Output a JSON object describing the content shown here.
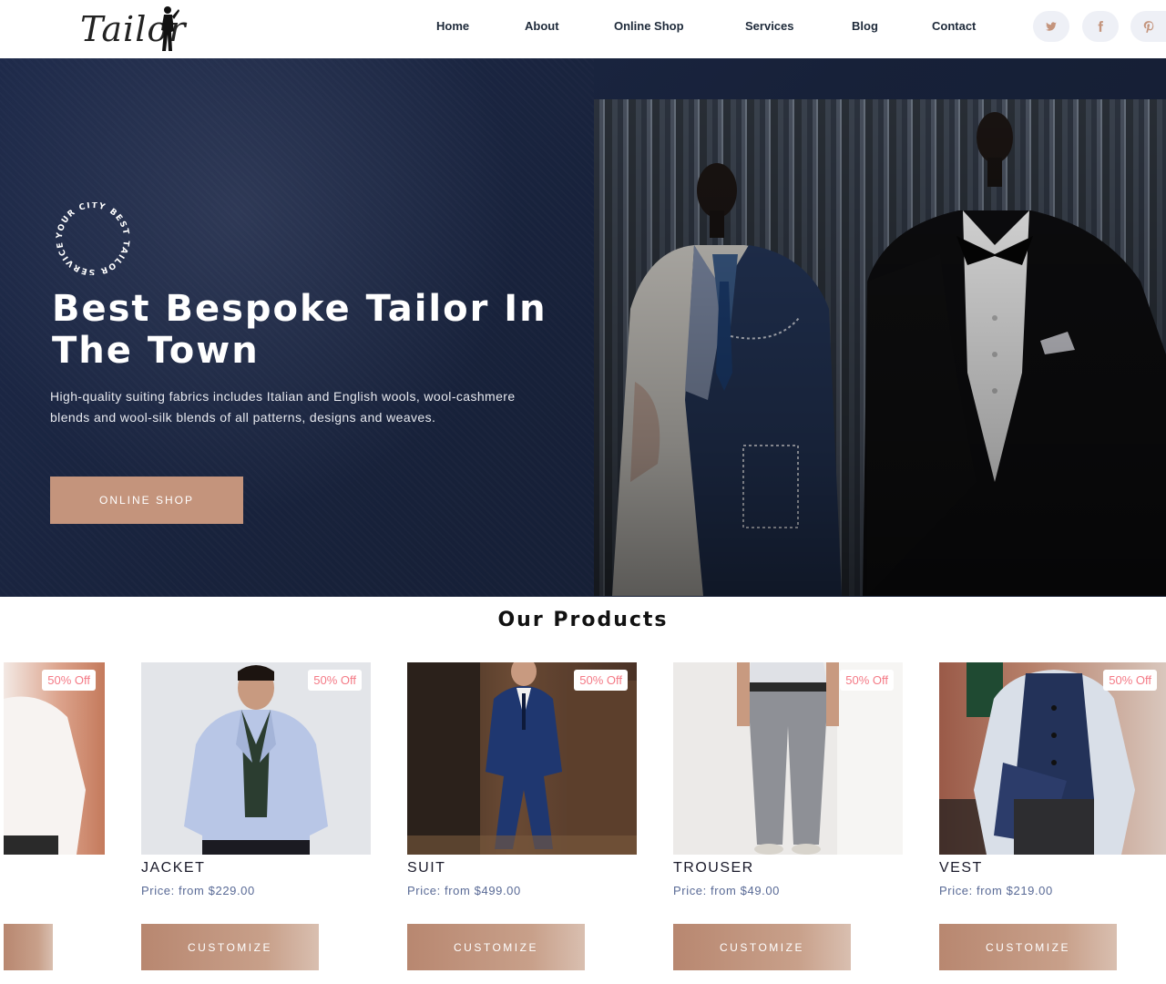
{
  "brand": {
    "logo_text": "Tailor"
  },
  "nav": {
    "items": [
      "Home",
      "About",
      "Online Shop",
      "Services",
      "Blog",
      "Contact"
    ]
  },
  "social": [
    "twitter-icon",
    "facebook-icon",
    "pinterest-icon"
  ],
  "colors": {
    "accent": "#c4947c",
    "hero_bg": "#172139",
    "discount": "#f47a86",
    "price": "#596a96"
  },
  "hero": {
    "badge_text": "YOUR CITY BEST TAILOR SERVICE IN",
    "title_line1": "Best Bespoke Tailor In",
    "title_line2": "The Town",
    "description": "High-quality suiting fabrics includes Italian and English wools, wool-cashmere blends and wool-silk blends of all patterns, designs and weaves.",
    "button": "ONLINE SHOP"
  },
  "products": {
    "title": "Our Products",
    "items": [
      {
        "name": "",
        "price": "",
        "discount": "50% Off",
        "button": ""
      },
      {
        "name": "JACKET",
        "price": "Price: from $229.00",
        "discount": "50% Off",
        "button": "CUSTOMIZE"
      },
      {
        "name": "SUIT",
        "price": "Price: from $499.00",
        "discount": "50% Off",
        "button": "CUSTOMIZE"
      },
      {
        "name": "TROUSER",
        "price": "Price: from $49.00",
        "discount": "50% Off",
        "button": "CUSTOMIZE"
      },
      {
        "name": "VEST",
        "price": "Price: from $219.00",
        "discount": "50% Off",
        "button": "CUSTOMIZE"
      }
    ]
  }
}
